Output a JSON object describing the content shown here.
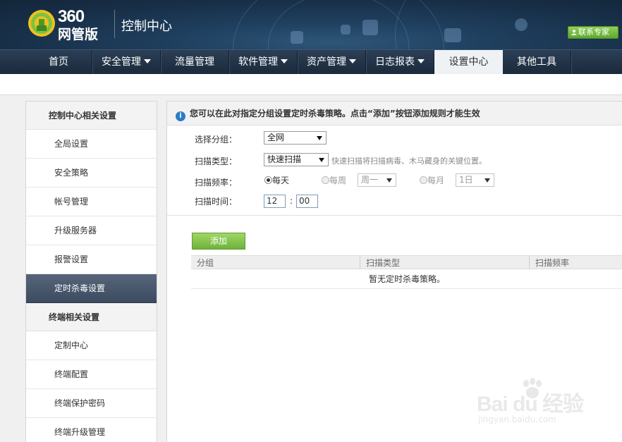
{
  "header": {
    "logo_number": "360",
    "logo_product": "网管版",
    "title": "控制中心",
    "contact_button": "联系专家"
  },
  "nav": {
    "items": [
      {
        "label": "首页",
        "dropdown": false
      },
      {
        "label": "安全管理",
        "dropdown": true
      },
      {
        "label": "流量管理",
        "dropdown": false
      },
      {
        "label": "软件管理",
        "dropdown": true
      },
      {
        "label": "资产管理",
        "dropdown": true
      },
      {
        "label": "日志报表",
        "dropdown": true
      },
      {
        "label": "设置中心",
        "dropdown": false,
        "active": true
      },
      {
        "label": "其他工具",
        "dropdown": false
      }
    ]
  },
  "sidebar": {
    "section1": "控制中心相关设置",
    "items1": [
      "全局设置",
      "安全策略",
      "帐号管理",
      "升级服务器",
      "报警设置",
      "定时杀毒设置"
    ],
    "section2": "终端相关设置",
    "items2": [
      "定制中心",
      "终端配置",
      "终端保护密码",
      "终端升级管理"
    ],
    "active_item": "定时杀毒设置"
  },
  "main": {
    "notice": "您可以在此对指定分组设置定时杀毒策略。点击“添加”按钮添加规则才能生效",
    "form": {
      "group_label": "选择分组：",
      "group_value": "全网",
      "scan_type_label": "扫描类型：",
      "scan_type_value": "快速扫描",
      "scan_type_hint": "快速扫描将扫描病毒、木马藏身的关键位置。",
      "frequency_label": "扫描频率：",
      "freq_daily": "每天",
      "freq_weekly": "每周",
      "weekday_value": "周一",
      "freq_monthly": "每月",
      "monthday_value": "1日",
      "time_label": "扫描时间：",
      "hour_value": "12",
      "time_colon": ":",
      "minute_value": "00"
    },
    "add_button": "添加",
    "table": {
      "columns": [
        "分组",
        "扫描类型",
        "扫描频率"
      ],
      "empty_text": "暂无定时杀毒策略。"
    }
  },
  "watermark": {
    "text": "Bai du 经验",
    "sub": "jingyan.baidu.com"
  },
  "colors": {
    "accent_green": "#6fb23b",
    "nav_dark": "#1b2a3c",
    "info_blue": "#2a7cc7"
  }
}
